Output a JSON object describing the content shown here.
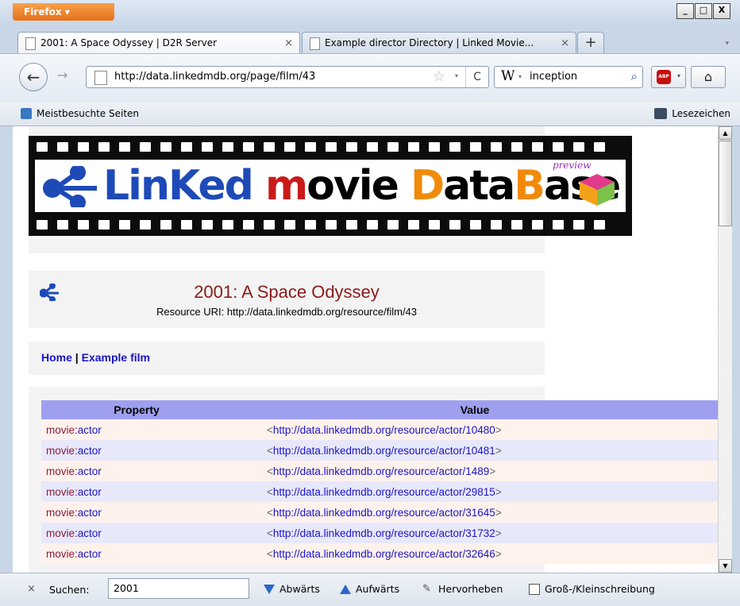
{
  "browser": {
    "menu_button": "Firefox ▾",
    "window_controls": [
      "_",
      "□",
      "X"
    ],
    "tabs": [
      {
        "title": "2001: A Space Odyssey | D2R Server",
        "close": "×"
      },
      {
        "title": "Example director Directory | Linked Movie...",
        "close": "×"
      }
    ],
    "new_tab": "+",
    "tab_menu": "▾",
    "back": "←",
    "forward": "→",
    "url": "http://data.linkedmdb.org/page/film/43",
    "star": "☆",
    "url_drop": "▾",
    "reload": "C",
    "search_engine": "W",
    "search_drop": "▾",
    "search_query": "inception",
    "search_icon": "⌕",
    "abp_label": "ABP",
    "abp_arrow": "▾",
    "home": "⌂",
    "bookmarks_toolbar": {
      "most_visited": "Meistbesuchte Seiten",
      "bookmarks": "Lesezeichen"
    },
    "scroll_up": "▲",
    "scroll_down": "▼"
  },
  "page": {
    "logo": {
      "part_linked": "LinKed ",
      "part_m": "m",
      "part_ovie": "ovie ",
      "part_d": "D",
      "part_ata": "ata",
      "part_b": "B",
      "part_ase": "ase",
      "preview": "preview"
    },
    "title": "2001: A Space Odyssey",
    "resource_uri": "Resource URI: http://data.linkedmdb.org/resource/film/43",
    "breadcrumb": {
      "home": "Home",
      "sep": " | ",
      "current": "Example film"
    },
    "table": {
      "headers": [
        "Property",
        "Value"
      ],
      "rows": [
        {
          "ns": "movie:",
          "local": "actor",
          "value": "http://data.linkedmdb.org/resource/actor/10480"
        },
        {
          "ns": "movie:",
          "local": "actor",
          "value": "http://data.linkedmdb.org/resource/actor/10481"
        },
        {
          "ns": "movie:",
          "local": "actor",
          "value": "http://data.linkedmdb.org/resource/actor/1489"
        },
        {
          "ns": "movie:",
          "local": "actor",
          "value": "http://data.linkedmdb.org/resource/actor/29815"
        },
        {
          "ns": "movie:",
          "local": "actor",
          "value": "http://data.linkedmdb.org/resource/actor/31645"
        },
        {
          "ns": "movie:",
          "local": "actor",
          "value": "http://data.linkedmdb.org/resource/actor/31732"
        },
        {
          "ns": "movie:",
          "local": "actor",
          "value": "http://data.linkedmdb.org/resource/actor/32646"
        }
      ]
    }
  },
  "findbar": {
    "close": "×",
    "label": "Suchen:",
    "query": "2001",
    "down": "Abwärts",
    "up": "Aufwärts",
    "highlight": "Hervorheben",
    "match_case": "Groß-/Kleinschreibung"
  },
  "colors": {
    "header_bg": "#9f9ff0",
    "row_odd": "#fff2ec",
    "row_even": "#e8e8fb",
    "link": "#1a14c9",
    "title": "#8b1a1a"
  }
}
